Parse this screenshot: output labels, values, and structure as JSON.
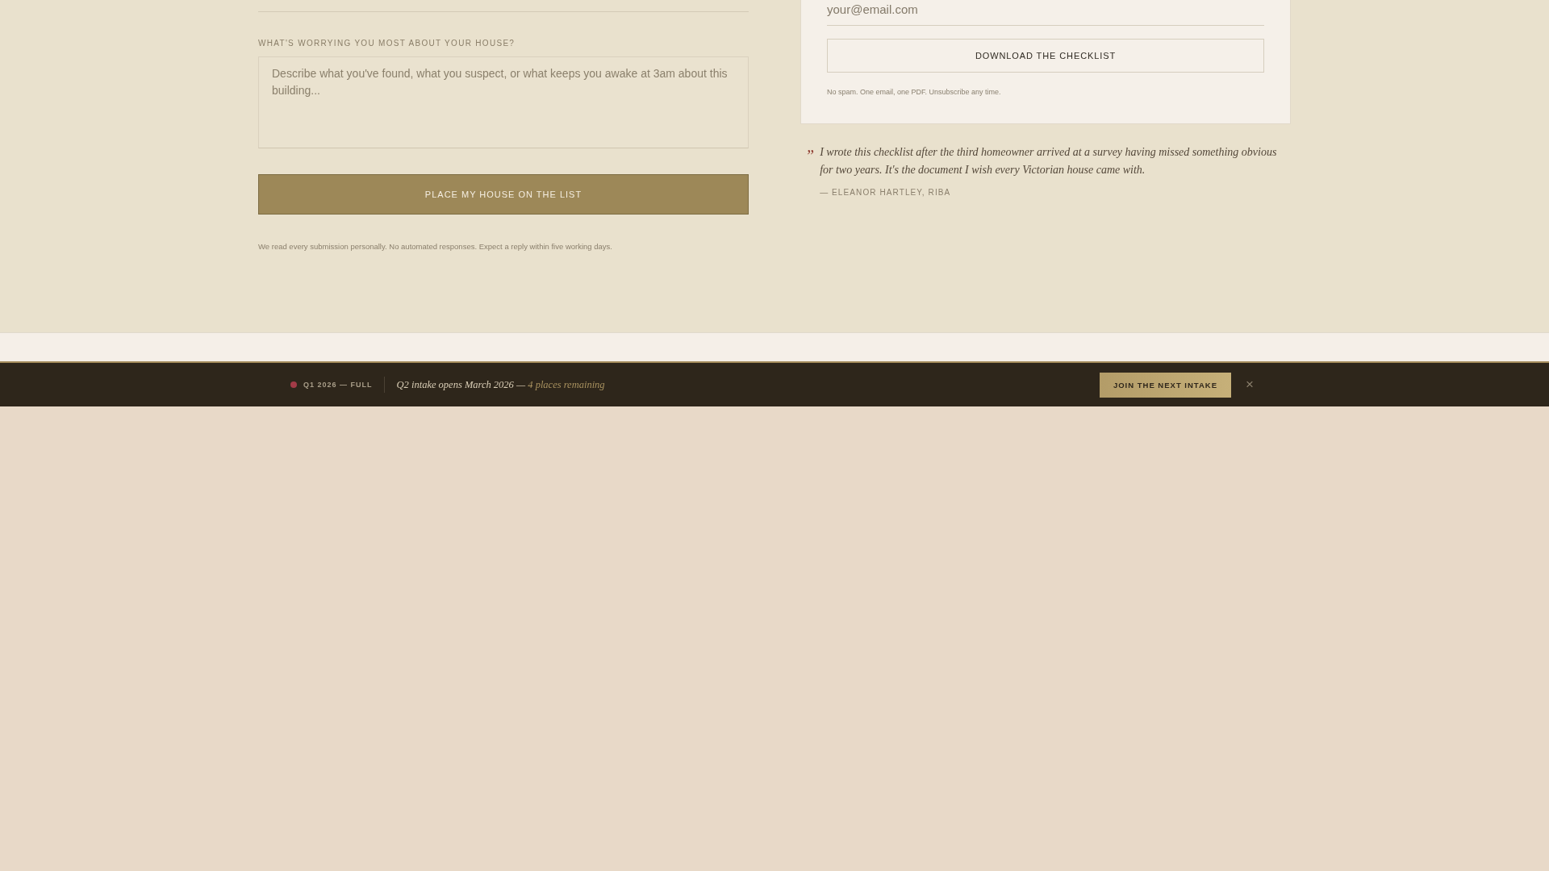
{
  "signup_form": {
    "concern_field": {
      "label": "WHAT'S WORRYING YOU MOST ABOUT YOUR HOUSE?",
      "placeholder": "Describe what you've found, what you suspect, or what keeps you awake at 3am about this building..."
    },
    "submit_button": "PLACE MY HOUSE ON THE LIST",
    "note": "We read every submission personally. No automated responses. Expect a reply within five working days."
  },
  "checklist_card": {
    "email_field": {
      "placeholder": "your@email.com"
    },
    "download_button": "DOWNLOAD THE CHECKLIST",
    "note": "No spam. One email, one PDF. Unsubscribe any time."
  },
  "testimonial": {
    "quote_mark": "”",
    "quote": "I wrote this checklist after the third homeowner arrived at a survey having missed something obvious for two years. It's the document I wish every Victorian house came with.",
    "attribution": "— ELEANOR HARTLEY, RIBA"
  },
  "intake_bar": {
    "status": {
      "label": "Q1 2026 — FULL",
      "color": "#a23b47"
    },
    "message": "Q2 intake opens March 2026 —",
    "highlight": "4 places remaining",
    "join_button": "JOIN THE NEXT INTAKE",
    "close": "×"
  }
}
